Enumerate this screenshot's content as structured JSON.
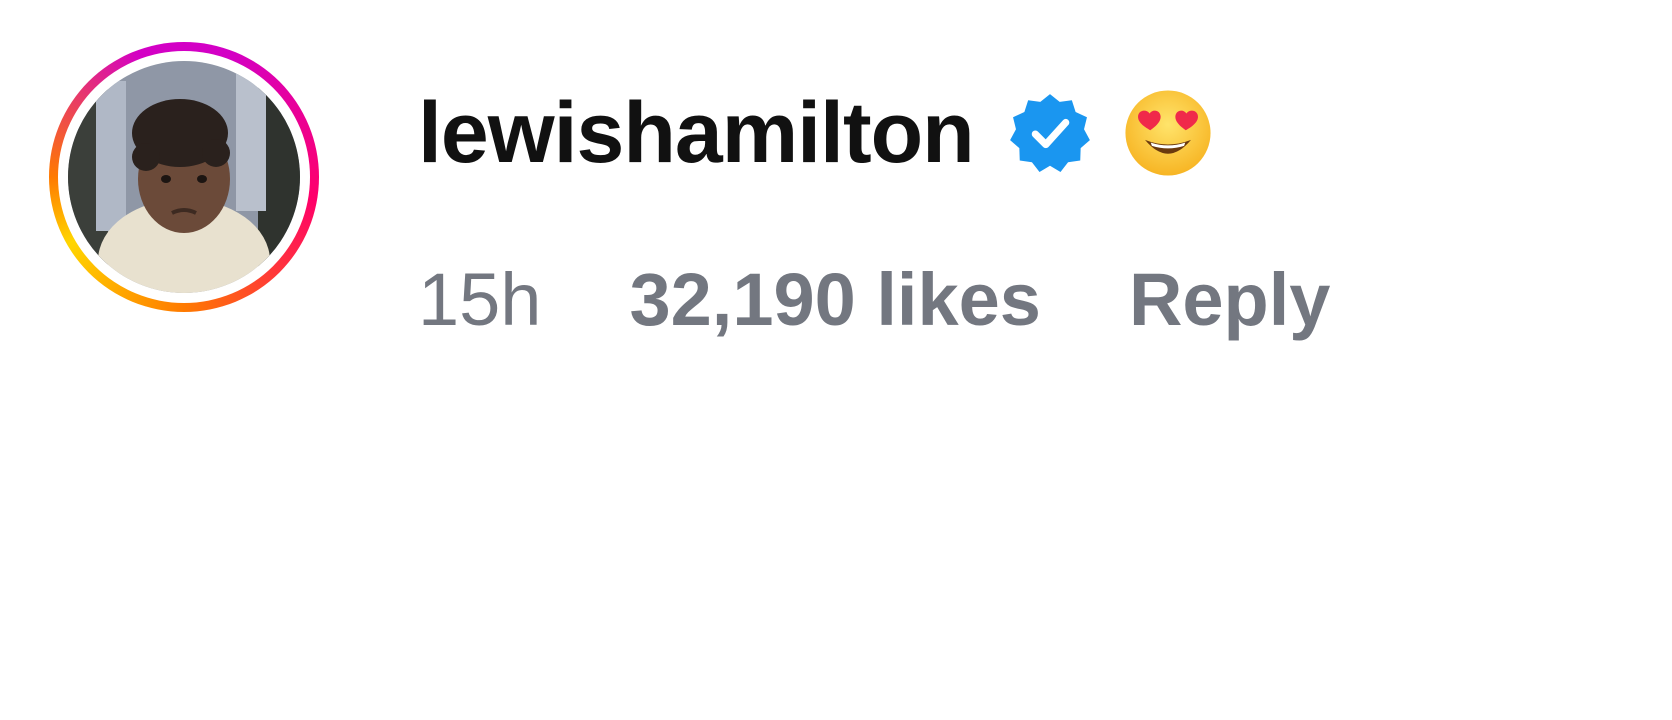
{
  "comment": {
    "username": "lewishamilton",
    "verified": true,
    "emoji_icon": "heart-eyes-emoji",
    "avatar_ring_colors": [
      "#d300c5",
      "#ff0069",
      "#ff7a00",
      "#ffd600"
    ],
    "verified_color": "#1a96f0",
    "timestamp": "15h",
    "likes_label": "32,190 likes",
    "reply_label": "Reply",
    "meta_color": "#737780"
  }
}
